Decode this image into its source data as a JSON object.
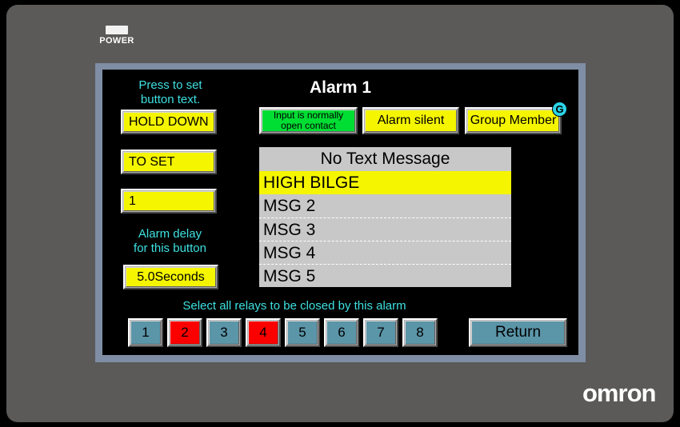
{
  "device": {
    "brand": "omron",
    "power_label": "POWER",
    "power_led_color": "#f2f2f2",
    "bezel_color": "#5b5a59",
    "frame_color": "#7f8ea4"
  },
  "screen": {
    "title": "Alarm 1",
    "background": "#000000",
    "accent_text_color": "#3fe0e0",
    "labels": {
      "press_to_set": "Press to set\nbutton text.",
      "press_to_set_line1": "Press to set",
      "press_to_set_line2": "button text.",
      "alarm_delay_line1": "Alarm delay",
      "alarm_delay_line2": "for this button",
      "select_relays": "Select all relays to be closed by this alarm"
    },
    "text_buttons": [
      {
        "label": "HOLD DOWN",
        "color": "#f5f500"
      },
      {
        "label": "TO SET",
        "color": "#f5f500"
      },
      {
        "label": "1",
        "color": "#f5f500"
      }
    ],
    "delay_button": {
      "label": "5.0Seconds",
      "color": "#f5f500"
    },
    "status_buttons": [
      {
        "label_line1": "Input is normally",
        "label_line2": "open contact",
        "color": "#00dd33"
      },
      {
        "label": "Alarm silent",
        "color": "#f5f500"
      },
      {
        "label": "Group Member",
        "color": "#f5f500"
      }
    ],
    "group_badge": {
      "label": "G",
      "color": "#2ad4e8"
    },
    "message_list": {
      "header": "No Text Message",
      "background": "#c8c8c8",
      "selected_color": "#f5f500",
      "rows": [
        {
          "label": "HIGH BILGE",
          "selected": true
        },
        {
          "label": "MSG 2",
          "selected": false
        },
        {
          "label": "MSG 3",
          "selected": false
        },
        {
          "label": "MSG 4",
          "selected": false
        },
        {
          "label": "MSG 5",
          "selected": false
        }
      ]
    },
    "relays": [
      {
        "label": "1",
        "active": false
      },
      {
        "label": "2",
        "active": true
      },
      {
        "label": "3",
        "active": false
      },
      {
        "label": "4",
        "active": true
      },
      {
        "label": "5",
        "active": false
      },
      {
        "label": "6",
        "active": false
      },
      {
        "label": "7",
        "active": false
      },
      {
        "label": "8",
        "active": false
      }
    ],
    "relay_colors": {
      "inactive": "#5b95a8",
      "active": "#fc0000"
    },
    "return_button": {
      "label": "Return",
      "color": "#5b95a8"
    }
  }
}
